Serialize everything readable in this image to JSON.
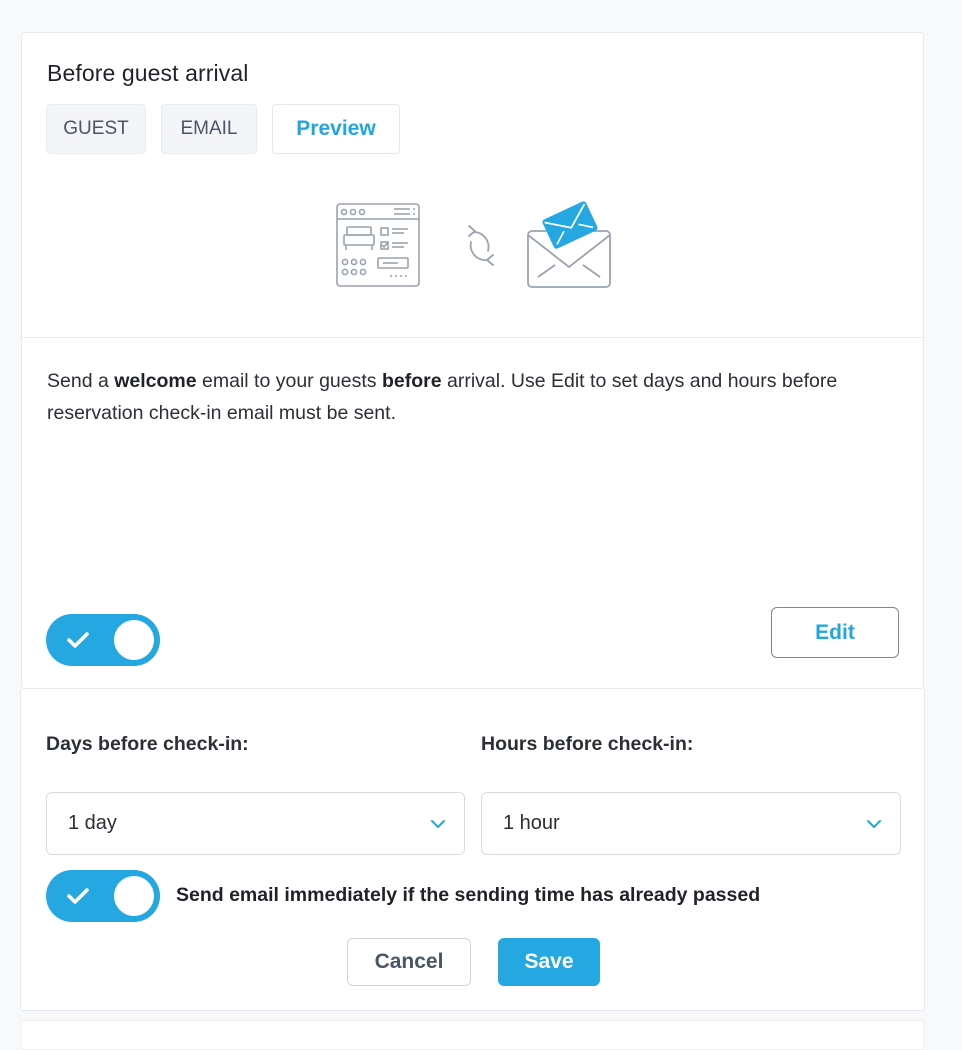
{
  "card": {
    "title": "Before guest arrival",
    "tabs": [
      {
        "label": "GUEST"
      },
      {
        "label": "EMAIL"
      },
      {
        "label": "Preview"
      }
    ],
    "description": {
      "p1": "Send a ",
      "b1": "welcome",
      "p2": " email to your guests ",
      "b2": "before",
      "p3": " arrival. Use Edit to set days and hours before reservation check-in email must be sent."
    },
    "enabled": true,
    "edit_label": "Edit"
  },
  "settings": {
    "days_label": "Days before check-in:",
    "days_value": "1 day",
    "hours_label": "Hours before check-in:",
    "hours_value": "1 hour",
    "send_immediately_label": "Send email immediately if the sending time has already passed",
    "send_immediately": true,
    "cancel_label": "Cancel",
    "save_label": "Save"
  },
  "icons": {
    "illustration_left": "reservation-calendar-icon",
    "illustration_middle": "sync-icon",
    "illustration_right": "envelope-icon"
  },
  "colors": {
    "accent": "#25a7e1",
    "text": "#2b2f36",
    "muted": "#4a5568",
    "border": "#e6e9ee"
  }
}
